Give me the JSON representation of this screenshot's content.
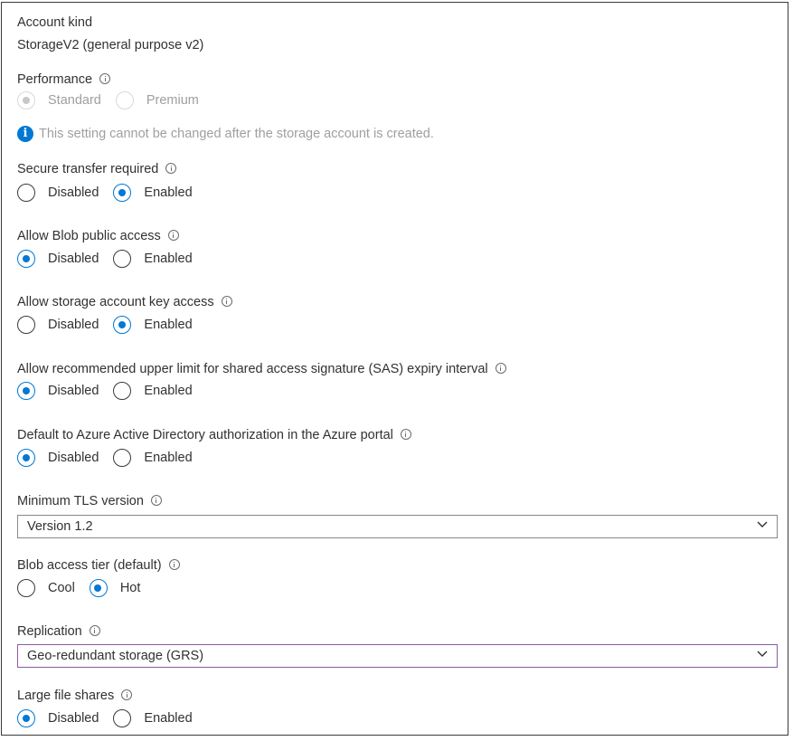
{
  "account_kind": {
    "label": "Account kind",
    "value": "StorageV2 (general purpose v2)"
  },
  "performance": {
    "label": "Performance",
    "options": [
      "Standard",
      "Premium"
    ],
    "selected": "Standard",
    "disabled": true,
    "note": "This setting cannot be changed after the storage account is created."
  },
  "secure_transfer": {
    "label": "Secure transfer required",
    "options": [
      "Disabled",
      "Enabled"
    ],
    "selected": "Enabled"
  },
  "blob_public_access": {
    "label": "Allow Blob public access",
    "options": [
      "Disabled",
      "Enabled"
    ],
    "selected": "Disabled"
  },
  "key_access": {
    "label": "Allow storage account key access",
    "options": [
      "Disabled",
      "Enabled"
    ],
    "selected": "Enabled"
  },
  "sas_expiry": {
    "label": "Allow recommended upper limit for shared access signature (SAS) expiry interval",
    "options": [
      "Disabled",
      "Enabled"
    ],
    "selected": "Disabled"
  },
  "aad_default": {
    "label": "Default to Azure Active Directory authorization in the Azure portal",
    "options": [
      "Disabled",
      "Enabled"
    ],
    "selected": "Disabled"
  },
  "min_tls": {
    "label": "Minimum TLS version",
    "value": "Version 1.2"
  },
  "blob_tier": {
    "label": "Blob access tier (default)",
    "options": [
      "Cool",
      "Hot"
    ],
    "selected": "Hot"
  },
  "replication": {
    "label": "Replication",
    "value": "Geo-redundant storage (GRS)"
  },
  "large_file_shares": {
    "label": "Large file shares",
    "options": [
      "Disabled",
      "Enabled"
    ],
    "selected": "Disabled"
  },
  "colors": {
    "accent": "#0078d4",
    "focus_border": "#8a5ca5",
    "text": "#323130",
    "disabled_text": "#a19f9d"
  },
  "icons": {
    "info": "info-icon",
    "chevron": "chevron-down-icon",
    "note": "info-filled-icon"
  }
}
